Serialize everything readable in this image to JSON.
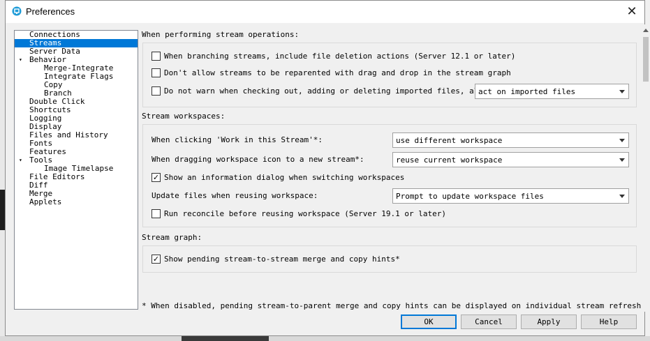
{
  "window": {
    "title": "Preferences"
  },
  "tree": {
    "items": [
      {
        "label": "Connections"
      },
      {
        "label": "Streams"
      },
      {
        "label": "Server Data"
      },
      {
        "label": "Behavior"
      },
      {
        "label": "Merge-Integrate"
      },
      {
        "label": "Integrate Flags"
      },
      {
        "label": "Copy"
      },
      {
        "label": "Branch"
      },
      {
        "label": "Double Click"
      },
      {
        "label": "Shortcuts"
      },
      {
        "label": "Logging"
      },
      {
        "label": "Display"
      },
      {
        "label": "Files and History"
      },
      {
        "label": "Fonts"
      },
      {
        "label": "Features"
      },
      {
        "label": "Tools"
      },
      {
        "label": "Image Timelapse"
      },
      {
        "label": "File Editors"
      },
      {
        "label": "Diff"
      },
      {
        "label": "Merge"
      },
      {
        "label": "Applets"
      }
    ],
    "selected": "Streams"
  },
  "stream_operations": {
    "heading": "When performing stream operations:",
    "include_deletions": {
      "label": "When branching streams, include file deletion actions (Server 12.1 or later)",
      "checked": false
    },
    "no_reparent_drag": {
      "label": "Don't allow streams to be reparented with drag and drop in the stream graph",
      "checked": false
    },
    "no_warn": {
      "label": "Do not warn when checking out, adding or deleting imported files, always",
      "checked": false
    },
    "imported_action": {
      "value": "act on imported files"
    }
  },
  "stream_workspaces": {
    "heading": "Stream workspaces:",
    "work_in_stream": {
      "label": "When clicking 'Work in this Stream'*:",
      "value": "use different workspace"
    },
    "drag_workspace": {
      "label": "When dragging workspace icon to a new stream*:",
      "value": "reuse current workspace"
    },
    "info_dialog": {
      "label": "Show an information dialog when switching workspaces",
      "checked": true
    },
    "update_files": {
      "label": "Update files when reusing workspace:",
      "value": "Prompt to update workspace files"
    },
    "reconcile": {
      "label": "Run reconcile before reusing workspace (Server 19.1 or later)",
      "checked": false
    }
  },
  "stream_graph": {
    "heading": "Stream graph:",
    "merge_hints": {
      "label": "Show pending stream-to-stream merge and copy hints*",
      "checked": true
    }
  },
  "footnote": "* When disabled, pending stream-to-parent merge and copy hints can be displayed on individual stream refresh",
  "buttons": {
    "ok": "OK",
    "cancel": "Cancel",
    "apply": "Apply",
    "help": "Help"
  },
  "colors": {
    "selection": "#0078d7",
    "dialog_bg": "#f0f0f0",
    "accent": "#1e9bd7"
  }
}
